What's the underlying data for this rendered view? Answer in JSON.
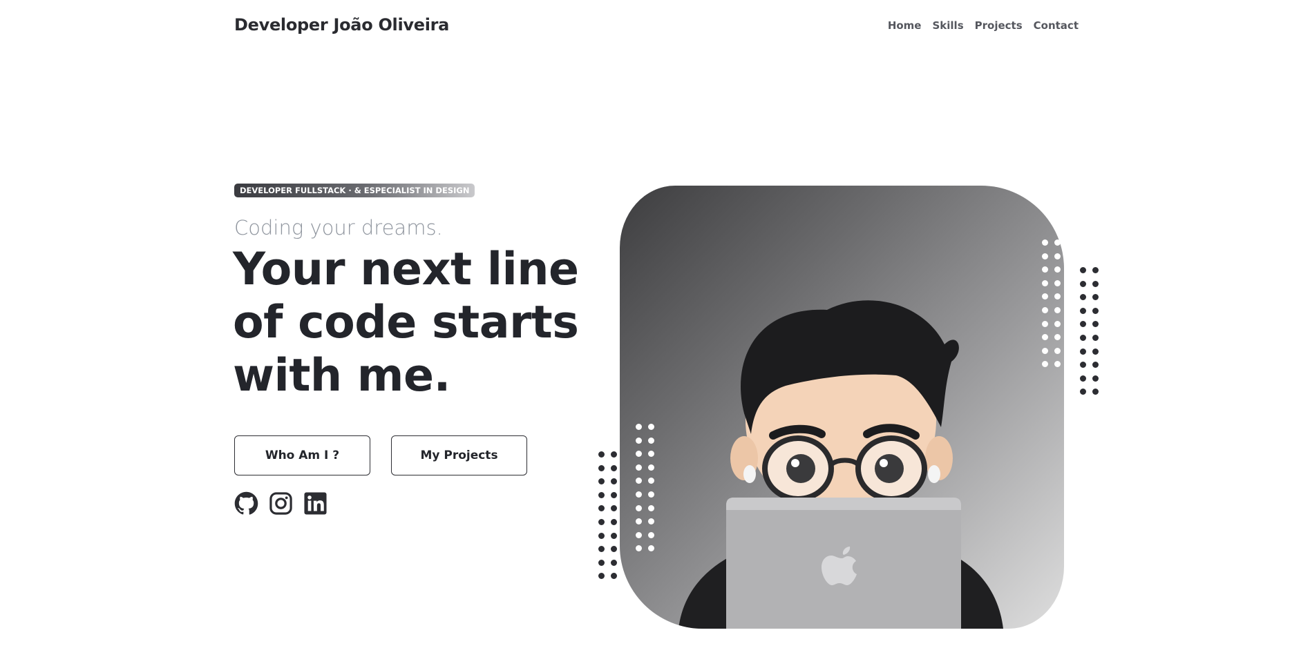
{
  "header": {
    "brand": "Developer João Oliveira",
    "nav": [
      "Home",
      "Skills",
      "Projects",
      "Contact"
    ]
  },
  "hero": {
    "badge": "DEVELOPER FULLSTACK · & ESPECIALIST IN DESIGN",
    "subtitle": "Coding your dreams.",
    "headline": [
      "Your next line",
      "of code starts",
      "with me."
    ],
    "buttons": {
      "who": "Who Am I ?",
      "projects": "My Projects"
    },
    "socials": [
      "github-icon",
      "instagram-icon",
      "linkedin-icon"
    ]
  },
  "colors": {
    "text": "#23252b",
    "muted": "#8f959e",
    "dots_dark": "#2c2d32",
    "dots_light": "#ffffff"
  }
}
